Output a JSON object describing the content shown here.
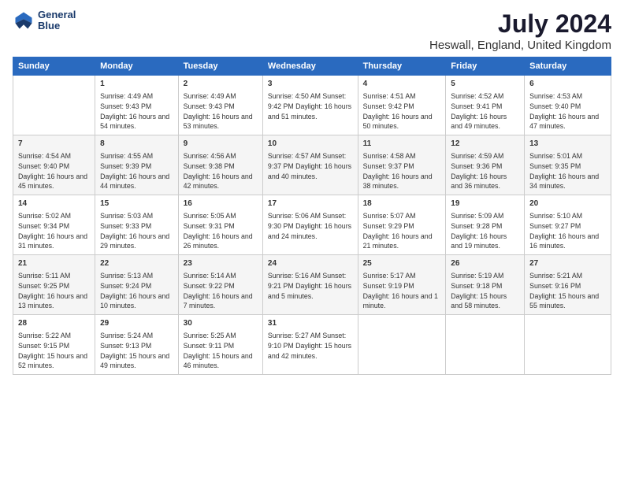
{
  "header": {
    "logo_line1": "General",
    "logo_line2": "Blue",
    "title": "July 2024",
    "subtitle": "Heswall, England, United Kingdom"
  },
  "columns": [
    "Sunday",
    "Monday",
    "Tuesday",
    "Wednesday",
    "Thursday",
    "Friday",
    "Saturday"
  ],
  "weeks": [
    [
      {
        "day": "",
        "info": ""
      },
      {
        "day": "1",
        "info": "Sunrise: 4:49 AM\nSunset: 9:43 PM\nDaylight: 16 hours\nand 54 minutes."
      },
      {
        "day": "2",
        "info": "Sunrise: 4:49 AM\nSunset: 9:43 PM\nDaylight: 16 hours\nand 53 minutes."
      },
      {
        "day": "3",
        "info": "Sunrise: 4:50 AM\nSunset: 9:42 PM\nDaylight: 16 hours\nand 51 minutes."
      },
      {
        "day": "4",
        "info": "Sunrise: 4:51 AM\nSunset: 9:42 PM\nDaylight: 16 hours\nand 50 minutes."
      },
      {
        "day": "5",
        "info": "Sunrise: 4:52 AM\nSunset: 9:41 PM\nDaylight: 16 hours\nand 49 minutes."
      },
      {
        "day": "6",
        "info": "Sunrise: 4:53 AM\nSunset: 9:40 PM\nDaylight: 16 hours\nand 47 minutes."
      }
    ],
    [
      {
        "day": "7",
        "info": "Sunrise: 4:54 AM\nSunset: 9:40 PM\nDaylight: 16 hours\nand 45 minutes."
      },
      {
        "day": "8",
        "info": "Sunrise: 4:55 AM\nSunset: 9:39 PM\nDaylight: 16 hours\nand 44 minutes."
      },
      {
        "day": "9",
        "info": "Sunrise: 4:56 AM\nSunset: 9:38 PM\nDaylight: 16 hours\nand 42 minutes."
      },
      {
        "day": "10",
        "info": "Sunrise: 4:57 AM\nSunset: 9:37 PM\nDaylight: 16 hours\nand 40 minutes."
      },
      {
        "day": "11",
        "info": "Sunrise: 4:58 AM\nSunset: 9:37 PM\nDaylight: 16 hours\nand 38 minutes."
      },
      {
        "day": "12",
        "info": "Sunrise: 4:59 AM\nSunset: 9:36 PM\nDaylight: 16 hours\nand 36 minutes."
      },
      {
        "day": "13",
        "info": "Sunrise: 5:01 AM\nSunset: 9:35 PM\nDaylight: 16 hours\nand 34 minutes."
      }
    ],
    [
      {
        "day": "14",
        "info": "Sunrise: 5:02 AM\nSunset: 9:34 PM\nDaylight: 16 hours\nand 31 minutes."
      },
      {
        "day": "15",
        "info": "Sunrise: 5:03 AM\nSunset: 9:33 PM\nDaylight: 16 hours\nand 29 minutes."
      },
      {
        "day": "16",
        "info": "Sunrise: 5:05 AM\nSunset: 9:31 PM\nDaylight: 16 hours\nand 26 minutes."
      },
      {
        "day": "17",
        "info": "Sunrise: 5:06 AM\nSunset: 9:30 PM\nDaylight: 16 hours\nand 24 minutes."
      },
      {
        "day": "18",
        "info": "Sunrise: 5:07 AM\nSunset: 9:29 PM\nDaylight: 16 hours\nand 21 minutes."
      },
      {
        "day": "19",
        "info": "Sunrise: 5:09 AM\nSunset: 9:28 PM\nDaylight: 16 hours\nand 19 minutes."
      },
      {
        "day": "20",
        "info": "Sunrise: 5:10 AM\nSunset: 9:27 PM\nDaylight: 16 hours\nand 16 minutes."
      }
    ],
    [
      {
        "day": "21",
        "info": "Sunrise: 5:11 AM\nSunset: 9:25 PM\nDaylight: 16 hours\nand 13 minutes."
      },
      {
        "day": "22",
        "info": "Sunrise: 5:13 AM\nSunset: 9:24 PM\nDaylight: 16 hours\nand 10 minutes."
      },
      {
        "day": "23",
        "info": "Sunrise: 5:14 AM\nSunset: 9:22 PM\nDaylight: 16 hours\nand 7 minutes."
      },
      {
        "day": "24",
        "info": "Sunrise: 5:16 AM\nSunset: 9:21 PM\nDaylight: 16 hours\nand 5 minutes."
      },
      {
        "day": "25",
        "info": "Sunrise: 5:17 AM\nSunset: 9:19 PM\nDaylight: 16 hours\nand 1 minute."
      },
      {
        "day": "26",
        "info": "Sunrise: 5:19 AM\nSunset: 9:18 PM\nDaylight: 15 hours\nand 58 minutes."
      },
      {
        "day": "27",
        "info": "Sunrise: 5:21 AM\nSunset: 9:16 PM\nDaylight: 15 hours\nand 55 minutes."
      }
    ],
    [
      {
        "day": "28",
        "info": "Sunrise: 5:22 AM\nSunset: 9:15 PM\nDaylight: 15 hours\nand 52 minutes."
      },
      {
        "day": "29",
        "info": "Sunrise: 5:24 AM\nSunset: 9:13 PM\nDaylight: 15 hours\nand 49 minutes."
      },
      {
        "day": "30",
        "info": "Sunrise: 5:25 AM\nSunset: 9:11 PM\nDaylight: 15 hours\nand 46 minutes."
      },
      {
        "day": "31",
        "info": "Sunrise: 5:27 AM\nSunset: 9:10 PM\nDaylight: 15 hours\nand 42 minutes."
      },
      {
        "day": "",
        "info": ""
      },
      {
        "day": "",
        "info": ""
      },
      {
        "day": "",
        "info": ""
      }
    ]
  ]
}
